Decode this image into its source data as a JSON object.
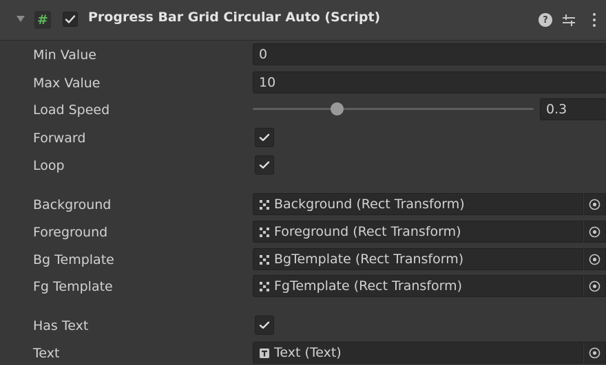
{
  "component": {
    "title": "Progress Bar Grid Circular Auto (Script)",
    "enabled": true,
    "script_icon": "#",
    "help_icon": "?"
  },
  "fields": {
    "min_value": {
      "label": "Min Value",
      "value": "0"
    },
    "max_value": {
      "label": "Max Value",
      "value": "10"
    },
    "load_speed": {
      "label": "Load Speed",
      "value": "0.3",
      "fraction": 0.3
    },
    "forward": {
      "label": "Forward",
      "checked": true
    },
    "loop": {
      "label": "Loop",
      "checked": true
    },
    "background": {
      "label": "Background",
      "value": "Background (Rect Transform)",
      "icon": "rect-transform-icon"
    },
    "foreground": {
      "label": "Foreground",
      "value": "Foreground (Rect Transform)",
      "icon": "rect-transform-icon"
    },
    "bg_template": {
      "label": "Bg Template",
      "value": "BgTemplate (Rect Transform)",
      "icon": "rect-transform-icon"
    },
    "fg_template": {
      "label": "Fg Template",
      "value": "FgTemplate (Rect Transform)",
      "icon": "rect-transform-icon"
    },
    "has_text": {
      "label": "Has Text",
      "checked": true
    },
    "text": {
      "label": "Text",
      "value": "Text (Text)",
      "icon": "text-component-icon"
    }
  },
  "colors": {
    "panel_bg": "#383838",
    "header_bg": "#3e3e3e",
    "field_bg": "#2a2a2a",
    "text": "#d2d2d2",
    "script_icon_green": "#5cb85c"
  }
}
